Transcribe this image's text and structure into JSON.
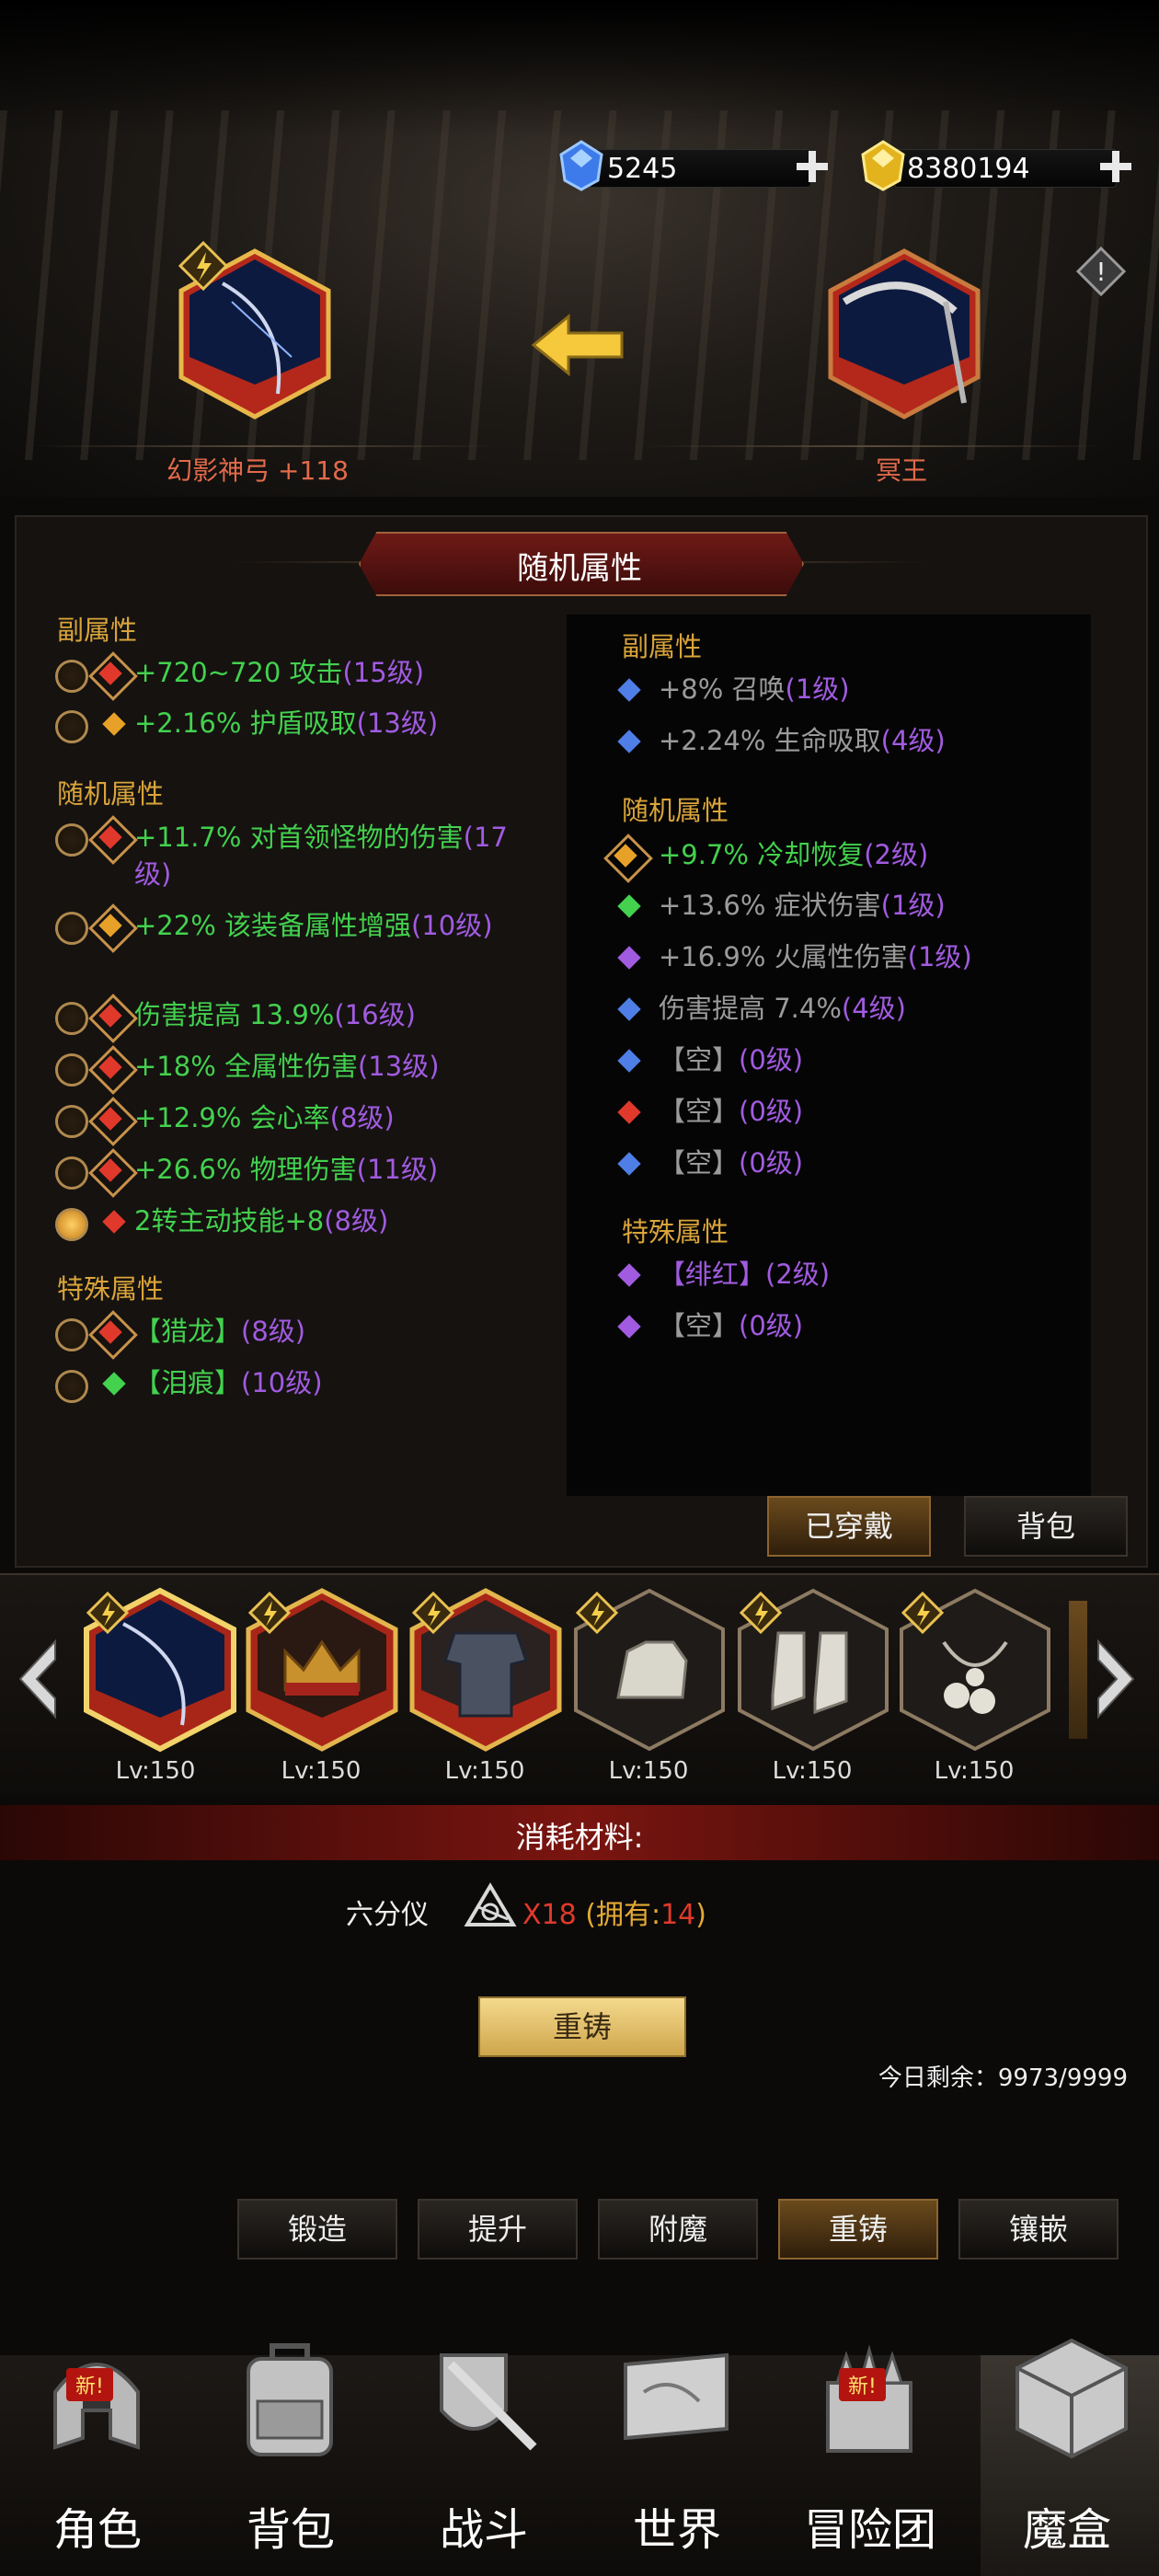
{
  "currency": {
    "gems": "5245",
    "gold": "8380194"
  },
  "top": {
    "left_item_name": "幻影神弓 +118",
    "right_item_name": "冥王",
    "swap_arrow": "left-arrow-icon",
    "info_icon": "!"
  },
  "panel_title": "随机属性",
  "left": {
    "sub_head": "副属性",
    "sub": [
      {
        "text": "+720~720 攻击",
        "level": "(15级)"
      },
      {
        "text": "+2.16% 护盾吸取",
        "level": "(13级)"
      }
    ],
    "rand_head": "随机属性",
    "rand": [
      {
        "text": "+11.7% 对首领怪物的伤害",
        "level": "(17级)"
      },
      {
        "text": "+22% 该装备属性增强",
        "level": "(10级)"
      },
      {
        "text": "伤害提高 13.9%",
        "level": "(16级)"
      },
      {
        "text": "+18% 全属性伤害",
        "level": "(13级)"
      },
      {
        "text": "+12.9% 会心率",
        "level": "(8级)"
      },
      {
        "text": "+26.6% 物理伤害",
        "level": "(11级)"
      },
      {
        "text": "2转主动技能+8",
        "level": "(8级)"
      }
    ],
    "special_head": "特殊属性",
    "special": [
      {
        "text": "【猎龙】",
        "level": "(8级)"
      },
      {
        "text": "【泪痕】",
        "level": "(10级)"
      }
    ]
  },
  "right": {
    "sub_head": "副属性",
    "sub": [
      {
        "text": "+8% 召唤",
        "level": "(1级)"
      },
      {
        "text": "+2.24% 生命吸取",
        "level": "(4级)"
      }
    ],
    "rand_head": "随机属性",
    "rand": [
      {
        "text": "+9.7% 冷却恢复",
        "level": "(2级)"
      },
      {
        "text": "+13.6% 症状伤害",
        "level": "(1级)"
      },
      {
        "text": "+16.9% 火属性伤害",
        "level": "(1级)"
      },
      {
        "text": "伤害提高 7.4%",
        "level": "(4级)"
      },
      {
        "text": "【空】",
        "level": "(0级)"
      },
      {
        "text": "【空】",
        "level": "(0级)"
      },
      {
        "text": "【空】",
        "level": "(0级)"
      }
    ],
    "special_head": "特殊属性",
    "special": [
      {
        "text": "【绯红】",
        "level": "(2级)"
      },
      {
        "text": "【空】",
        "level": "(0级)"
      }
    ]
  },
  "buttons": {
    "equipped": "已穿戴",
    "bag": "背包"
  },
  "equipment_slots": [
    {
      "level": "Lv:150",
      "icon": "bow-icon"
    },
    {
      "level": "Lv:150",
      "icon": "crown-icon"
    },
    {
      "level": "Lv:150",
      "icon": "armor-icon"
    },
    {
      "level": "Lv:150",
      "icon": "gauntlet-icon"
    },
    {
      "level": "Lv:150",
      "icon": "boots-icon"
    },
    {
      "level": "Lv:150",
      "icon": "necklace-icon"
    }
  ],
  "materials": {
    "header": "消耗材料:",
    "item_name": "六分仪",
    "qty": "X18",
    "owned_label": "(拥有:",
    "owned_value": "14",
    "owned_close": ")"
  },
  "reforge_button": "重铸",
  "daily": "今日剩余：9973/9999",
  "tabs": [
    "锻造",
    "提升",
    "附魔",
    "重铸",
    "镶嵌"
  ],
  "nav": [
    {
      "label": "角色",
      "icon": "helmet-icon",
      "badge": "新!"
    },
    {
      "label": "背包",
      "icon": "backpack-icon",
      "badge": ""
    },
    {
      "label": "战斗",
      "icon": "sword-shield-icon",
      "badge": ""
    },
    {
      "label": "世界",
      "icon": "map-scroll-icon",
      "badge": ""
    },
    {
      "label": "冒险团",
      "icon": "castle-icon",
      "badge": "新!"
    },
    {
      "label": "魔盒",
      "icon": "cube-icon",
      "badge": ""
    }
  ],
  "colors": {
    "green": "#43d14e",
    "purple": "#a15be0",
    "gold": "#d9a43a",
    "red": "#e0392b",
    "gray": "#9b9b9b"
  }
}
